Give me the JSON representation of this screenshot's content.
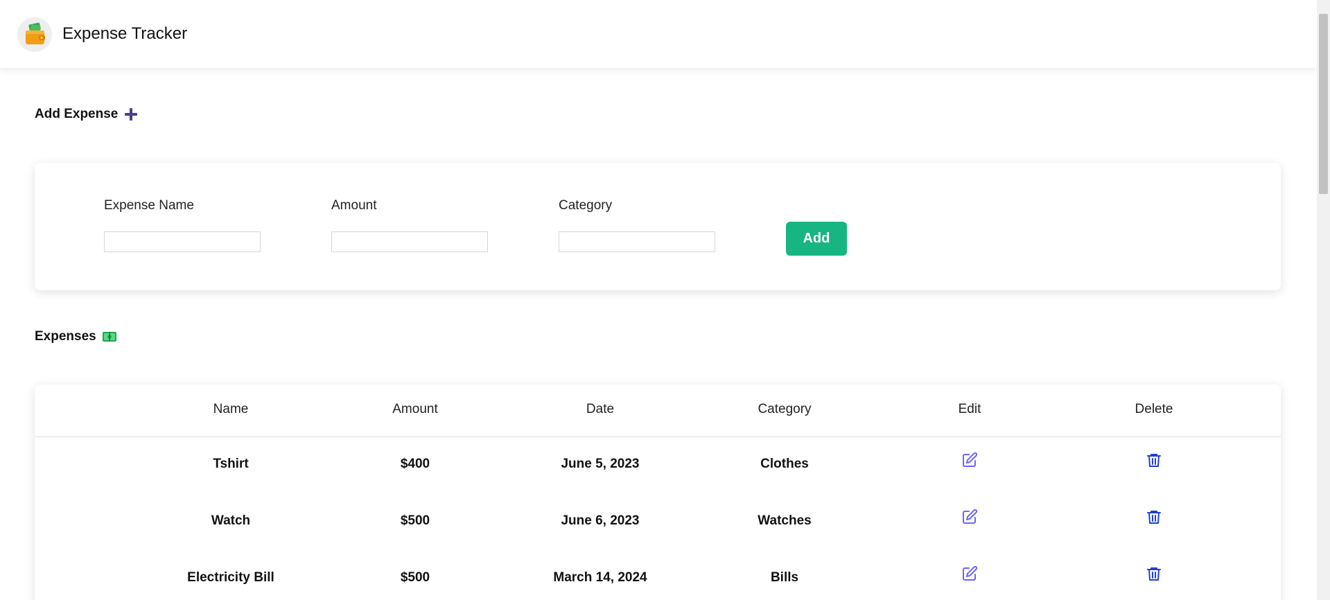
{
  "app": {
    "title": "Expense Tracker",
    "logo_icon": "wallet-with-money-icon"
  },
  "add_section": {
    "title": "Add Expense",
    "icon": "plus-icon",
    "fields": [
      {
        "label": "Expense Name",
        "value": "",
        "placeholder": ""
      },
      {
        "label": "Amount",
        "value": "",
        "placeholder": ""
      },
      {
        "label": "Category",
        "value": "",
        "placeholder": ""
      }
    ],
    "add_button_label": "Add",
    "add_button_color": "#17b581"
  },
  "expenses_section": {
    "title": "Expenses",
    "icon": "cash-icon",
    "columns": [
      "Name",
      "Amount",
      "Date",
      "Category",
      "Edit",
      "Delete"
    ],
    "rows": [
      {
        "name": "Tshirt",
        "amount": "$400",
        "date": "June 5, 2023",
        "category": "Clothes"
      },
      {
        "name": "Watch",
        "amount": "$500",
        "date": "June 6, 2023",
        "category": "Watches"
      },
      {
        "name": "Electricity Bill",
        "amount": "$500",
        "date": "March 14, 2024",
        "category": "Bills"
      }
    ],
    "edit_icon": "edit-icon",
    "delete_icon": "trash-icon",
    "edit_icon_color": "#6c63ff",
    "delete_icon_color": "#1f3fd1"
  }
}
